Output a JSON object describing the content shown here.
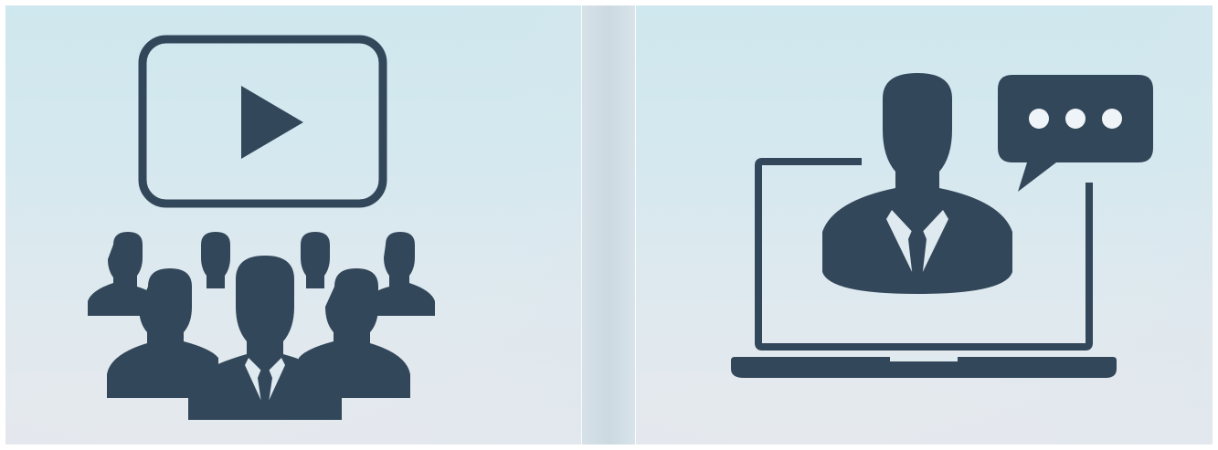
{
  "icon_color": "#33475a",
  "background_colors": [
    "#cfe7ee",
    "#e6e9ee"
  ],
  "panels": [
    {
      "icons": [
        "video-screen-icon",
        "play-icon",
        "audience-group-icon"
      ]
    },
    {
      "icons": [
        "laptop-icon",
        "presenter-person-icon",
        "speech-bubble-icon"
      ]
    }
  ]
}
